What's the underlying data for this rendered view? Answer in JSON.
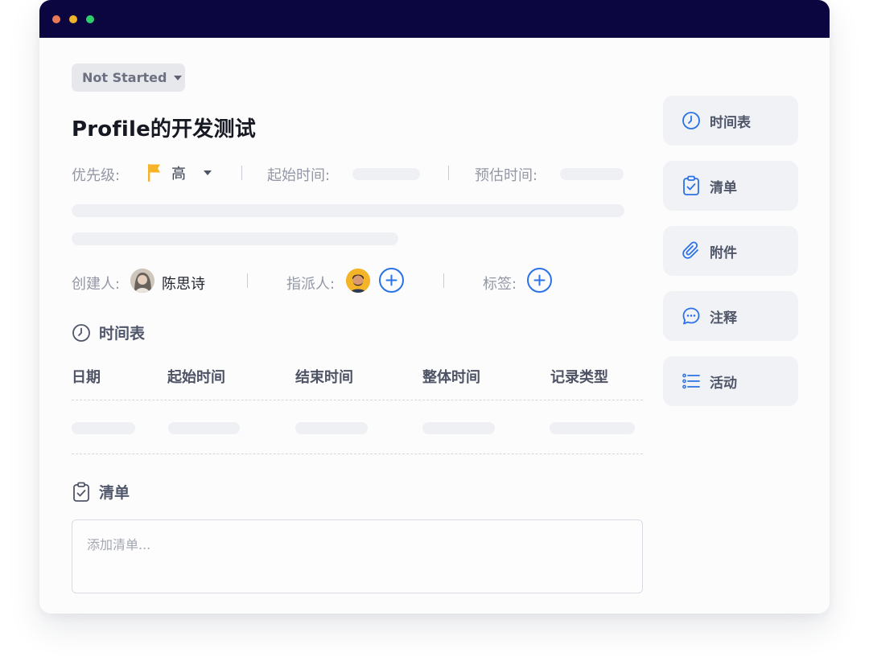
{
  "window": {
    "dots": [
      "#e97a55",
      "#efb32c",
      "#2fcf6b"
    ]
  },
  "status": {
    "label": "Not Started"
  },
  "task": {
    "title": "Profile的开发测试"
  },
  "meta": {
    "priority_label": "优先级:",
    "priority_value": "高",
    "priority_color": "#f5b325",
    "start_label": "起始时间:",
    "estimate_label": "预估时间:"
  },
  "people": {
    "creator_label": "创建人:",
    "creator_name": "陈思诗",
    "assignee_label": "指派人:",
    "tag_label": "标签:"
  },
  "timesheet": {
    "title": "时间表",
    "columns": [
      "日期",
      "起始时间",
      "结束时间",
      "整体时间",
      "记录类型"
    ]
  },
  "checklist": {
    "title": "清单",
    "placeholder": "添加清单..."
  },
  "sidebar": {
    "items": [
      {
        "label": "时间表",
        "icon": "clock-icon"
      },
      {
        "label": "清单",
        "icon": "clipboard-check-icon"
      },
      {
        "label": "附件",
        "icon": "paperclip-icon"
      },
      {
        "label": "注释",
        "icon": "comment-icon"
      },
      {
        "label": "活动",
        "icon": "list-icon"
      }
    ]
  },
  "colors": {
    "accent": "#2b72e6",
    "titlebar": "#0c0640"
  }
}
